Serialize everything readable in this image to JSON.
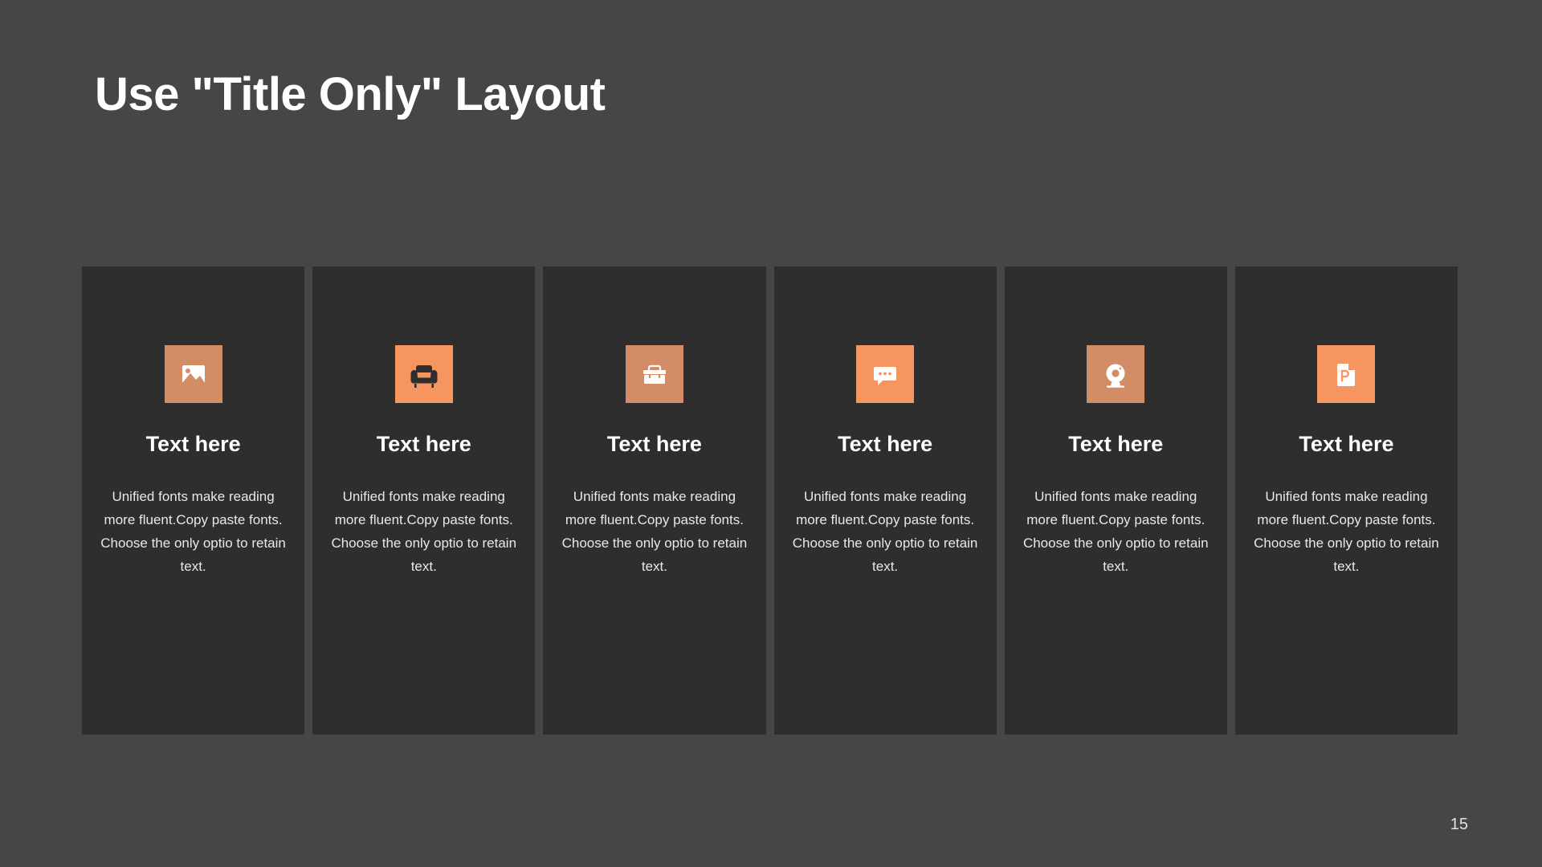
{
  "slide": {
    "title": "Use \"Title Only\" Layout",
    "page_number": "15",
    "background_color": "#464646",
    "card_color": "#2e2e2e"
  },
  "cards": [
    {
      "icon": "image-icon",
      "icon_bg": "#d28c66",
      "icon_fg": "#ffffff",
      "heading": "Text here",
      "body": "Unified  fonts make reading more fluent.Copy paste fonts. Choose the only optio to retain text."
    },
    {
      "icon": "armchair-icon",
      "icon_bg": "#f79560",
      "icon_fg": "#2e2e2e",
      "heading": "Text here",
      "body": "Unified  fonts make reading more fluent.Copy paste fonts. Choose the only optio to retain text."
    },
    {
      "icon": "toolbox-icon",
      "icon_bg": "#d28c66",
      "icon_fg": "#ffffff",
      "heading": "Text here",
      "body": "Unified  fonts make reading more fluent.Copy paste fonts. Choose the only optio to retain text."
    },
    {
      "icon": "chat-bubble-icon",
      "icon_bg": "#f79560",
      "icon_fg": "#ffffff",
      "heading": "Text here",
      "body": "Unified  fonts make reading more fluent.Copy paste fonts. Choose the only optio to retain text."
    },
    {
      "icon": "webcam-icon",
      "icon_bg": "#d28c66",
      "icon_fg": "#ffffff",
      "heading": "Text here",
      "body": "Unified  fonts make reading more fluent.Copy paste fonts. Choose the only optio to retain text."
    },
    {
      "icon": "powerpoint-file-icon",
      "icon_bg": "#f79560",
      "icon_fg": "#ffffff",
      "heading": "Text here",
      "body": "Unified  fonts make reading more fluent.Copy paste fonts. Choose the only optio to retain text."
    }
  ]
}
